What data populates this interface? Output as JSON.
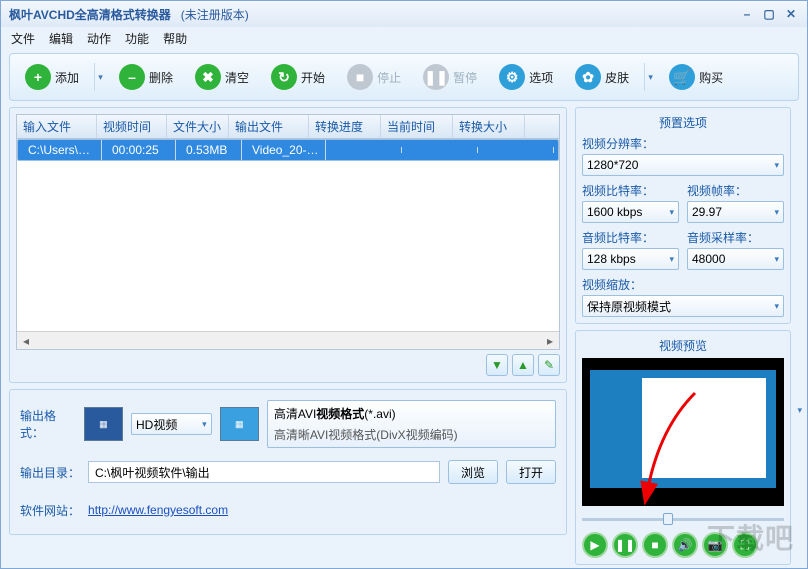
{
  "title": "枫叶AVCHD全高清格式转换器",
  "unregistered": "(未注册版本)",
  "menu": [
    "文件",
    "编辑",
    "动作",
    "功能",
    "帮助"
  ],
  "toolbar": {
    "add": "添加",
    "delete": "删除",
    "clear": "清空",
    "start": "开始",
    "stop": "停止",
    "pause": "暂停",
    "options": "选项",
    "skin": "皮肤",
    "buy": "购买"
  },
  "table": {
    "headers": [
      "输入文件",
      "视频时间",
      "文件大小",
      "输出文件",
      "转换进度",
      "当前时间",
      "转换大小"
    ],
    "rows": [
      {
        "input": "C:\\Users\\pc\\..",
        "vtime": "00:00:25",
        "fsize": "0.53MB",
        "output": "Video_20-0..",
        "progress": "",
        "curtime": "",
        "convsize": ""
      }
    ]
  },
  "output": {
    "format_label": "输出格式：",
    "profile_name": "HD视频",
    "format_title_prefix": "高清AVI",
    "format_title_bold": "视频格式",
    "format_title_suffix": "(*.avi)",
    "format_desc": "高清晰AVI视频格式(DivX视频编码)",
    "dir_label": "输出目录：",
    "dir_value": "C:\\枫叶视频软件\\输出",
    "browse": "浏览",
    "open": "打开",
    "site_label": "软件网站：",
    "site_url": "http://www.fengyesoft.com"
  },
  "preset": {
    "title": "预置选项",
    "res_label": "视频分辨率：",
    "res_value": "1280*720",
    "vbitrate_label": "视频比特率：",
    "vbitrate_value": "1600 kbps",
    "fps_label": "视频帧率：",
    "fps_value": "29.97",
    "abitrate_label": "音频比特率：",
    "abitrate_value": "128 kbps",
    "asample_label": "音频采样率：",
    "asample_value": "48000",
    "scale_label": "视频缩放：",
    "scale_value": "保持原视频模式"
  },
  "preview": {
    "title": "视频预览"
  },
  "watermark": "下载吧"
}
